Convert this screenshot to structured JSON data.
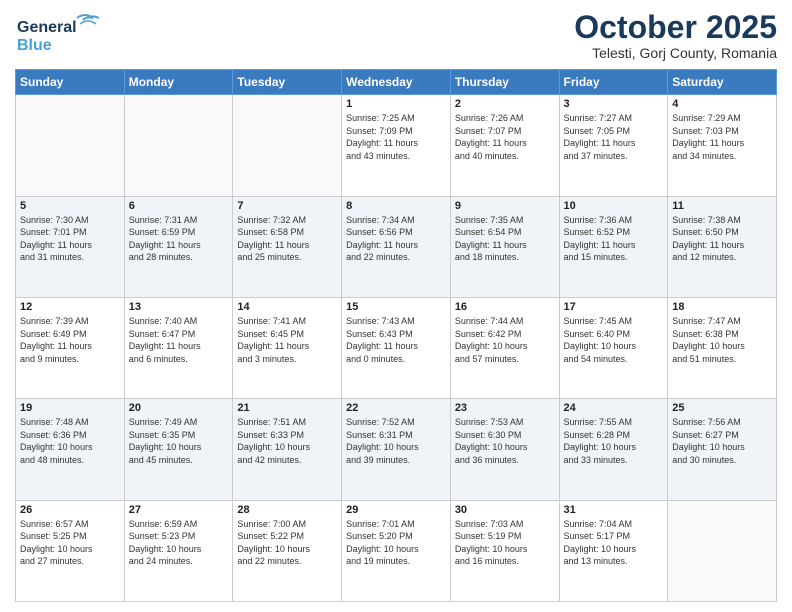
{
  "header": {
    "logo_line1": "General",
    "logo_line2": "Blue",
    "month": "October 2025",
    "location": "Telesti, Gorj County, Romania"
  },
  "days_of_week": [
    "Sunday",
    "Monday",
    "Tuesday",
    "Wednesday",
    "Thursday",
    "Friday",
    "Saturday"
  ],
  "weeks": [
    [
      {
        "num": "",
        "info": ""
      },
      {
        "num": "",
        "info": ""
      },
      {
        "num": "",
        "info": ""
      },
      {
        "num": "1",
        "info": "Sunrise: 7:25 AM\nSunset: 7:09 PM\nDaylight: 11 hours\nand 43 minutes."
      },
      {
        "num": "2",
        "info": "Sunrise: 7:26 AM\nSunset: 7:07 PM\nDaylight: 11 hours\nand 40 minutes."
      },
      {
        "num": "3",
        "info": "Sunrise: 7:27 AM\nSunset: 7:05 PM\nDaylight: 11 hours\nand 37 minutes."
      },
      {
        "num": "4",
        "info": "Sunrise: 7:29 AM\nSunset: 7:03 PM\nDaylight: 11 hours\nand 34 minutes."
      }
    ],
    [
      {
        "num": "5",
        "info": "Sunrise: 7:30 AM\nSunset: 7:01 PM\nDaylight: 11 hours\nand 31 minutes."
      },
      {
        "num": "6",
        "info": "Sunrise: 7:31 AM\nSunset: 6:59 PM\nDaylight: 11 hours\nand 28 minutes."
      },
      {
        "num": "7",
        "info": "Sunrise: 7:32 AM\nSunset: 6:58 PM\nDaylight: 11 hours\nand 25 minutes."
      },
      {
        "num": "8",
        "info": "Sunrise: 7:34 AM\nSunset: 6:56 PM\nDaylight: 11 hours\nand 22 minutes."
      },
      {
        "num": "9",
        "info": "Sunrise: 7:35 AM\nSunset: 6:54 PM\nDaylight: 11 hours\nand 18 minutes."
      },
      {
        "num": "10",
        "info": "Sunrise: 7:36 AM\nSunset: 6:52 PM\nDaylight: 11 hours\nand 15 minutes."
      },
      {
        "num": "11",
        "info": "Sunrise: 7:38 AM\nSunset: 6:50 PM\nDaylight: 11 hours\nand 12 minutes."
      }
    ],
    [
      {
        "num": "12",
        "info": "Sunrise: 7:39 AM\nSunset: 6:49 PM\nDaylight: 11 hours\nand 9 minutes."
      },
      {
        "num": "13",
        "info": "Sunrise: 7:40 AM\nSunset: 6:47 PM\nDaylight: 11 hours\nand 6 minutes."
      },
      {
        "num": "14",
        "info": "Sunrise: 7:41 AM\nSunset: 6:45 PM\nDaylight: 11 hours\nand 3 minutes."
      },
      {
        "num": "15",
        "info": "Sunrise: 7:43 AM\nSunset: 6:43 PM\nDaylight: 11 hours\nand 0 minutes."
      },
      {
        "num": "16",
        "info": "Sunrise: 7:44 AM\nSunset: 6:42 PM\nDaylight: 10 hours\nand 57 minutes."
      },
      {
        "num": "17",
        "info": "Sunrise: 7:45 AM\nSunset: 6:40 PM\nDaylight: 10 hours\nand 54 minutes."
      },
      {
        "num": "18",
        "info": "Sunrise: 7:47 AM\nSunset: 6:38 PM\nDaylight: 10 hours\nand 51 minutes."
      }
    ],
    [
      {
        "num": "19",
        "info": "Sunrise: 7:48 AM\nSunset: 6:36 PM\nDaylight: 10 hours\nand 48 minutes."
      },
      {
        "num": "20",
        "info": "Sunrise: 7:49 AM\nSunset: 6:35 PM\nDaylight: 10 hours\nand 45 minutes."
      },
      {
        "num": "21",
        "info": "Sunrise: 7:51 AM\nSunset: 6:33 PM\nDaylight: 10 hours\nand 42 minutes."
      },
      {
        "num": "22",
        "info": "Sunrise: 7:52 AM\nSunset: 6:31 PM\nDaylight: 10 hours\nand 39 minutes."
      },
      {
        "num": "23",
        "info": "Sunrise: 7:53 AM\nSunset: 6:30 PM\nDaylight: 10 hours\nand 36 minutes."
      },
      {
        "num": "24",
        "info": "Sunrise: 7:55 AM\nSunset: 6:28 PM\nDaylight: 10 hours\nand 33 minutes."
      },
      {
        "num": "25",
        "info": "Sunrise: 7:56 AM\nSunset: 6:27 PM\nDaylight: 10 hours\nand 30 minutes."
      }
    ],
    [
      {
        "num": "26",
        "info": "Sunrise: 6:57 AM\nSunset: 5:25 PM\nDaylight: 10 hours\nand 27 minutes."
      },
      {
        "num": "27",
        "info": "Sunrise: 6:59 AM\nSunset: 5:23 PM\nDaylight: 10 hours\nand 24 minutes."
      },
      {
        "num": "28",
        "info": "Sunrise: 7:00 AM\nSunset: 5:22 PM\nDaylight: 10 hours\nand 22 minutes."
      },
      {
        "num": "29",
        "info": "Sunrise: 7:01 AM\nSunset: 5:20 PM\nDaylight: 10 hours\nand 19 minutes."
      },
      {
        "num": "30",
        "info": "Sunrise: 7:03 AM\nSunset: 5:19 PM\nDaylight: 10 hours\nand 16 minutes."
      },
      {
        "num": "31",
        "info": "Sunrise: 7:04 AM\nSunset: 5:17 PM\nDaylight: 10 hours\nand 13 minutes."
      },
      {
        "num": "",
        "info": ""
      }
    ]
  ]
}
